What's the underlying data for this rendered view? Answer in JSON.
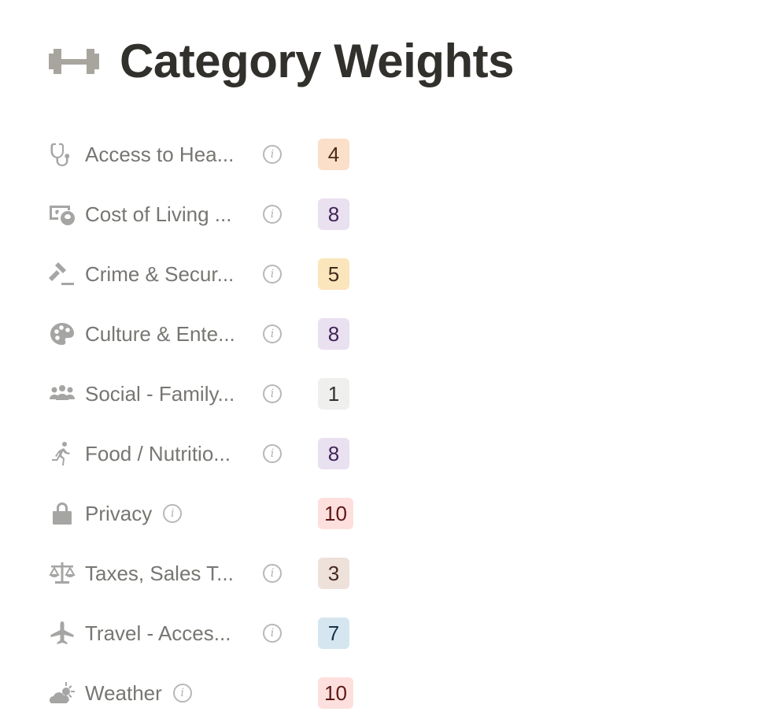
{
  "header": {
    "icon": "dumbbell-icon",
    "title": "Category Weights"
  },
  "categories": [
    {
      "icon": "stethoscope-icon",
      "label": "Access to Hea...",
      "weight": "4",
      "bg": "#fbdfc9",
      "fg": "#4a2a12"
    },
    {
      "icon": "money-exchange-icon",
      "label": "Cost of Living ...",
      "weight": "8",
      "bg": "#e9e0f0",
      "fg": "#412454"
    },
    {
      "icon": "gavel-icon",
      "label": "Crime & Secur...",
      "weight": "5",
      "bg": "#fbe5bc",
      "fg": "#402c1b"
    },
    {
      "icon": "palette-icon",
      "label": "Culture & Ente...",
      "weight": "8",
      "bg": "#e9e0f0",
      "fg": "#412454"
    },
    {
      "icon": "people-group-icon",
      "label": "Social - Family...",
      "weight": "1",
      "bg": "#efefed",
      "fg": "#32302c"
    },
    {
      "icon": "running-person-icon",
      "label": "Food / Nutritio...",
      "weight": "8",
      "bg": "#e9e0f0",
      "fg": "#412454"
    },
    {
      "icon": "lock-icon",
      "label": "Privacy",
      "weight": "10",
      "bg": "#fde0dd",
      "fg": "#5d1715"
    },
    {
      "icon": "scales-icon",
      "label": "Taxes, Sales T...",
      "weight": "3",
      "bg": "#eee1da",
      "fg": "#442a1e"
    },
    {
      "icon": "airplane-icon",
      "label": "Travel - Acces...",
      "weight": "7",
      "bg": "#d6e6f0",
      "fg": "#183347"
    },
    {
      "icon": "cloud-sun-icon",
      "label": "Weather",
      "weight": "10",
      "bg": "#fde0dd",
      "fg": "#5d1715"
    }
  ],
  "info_glyph": "i"
}
